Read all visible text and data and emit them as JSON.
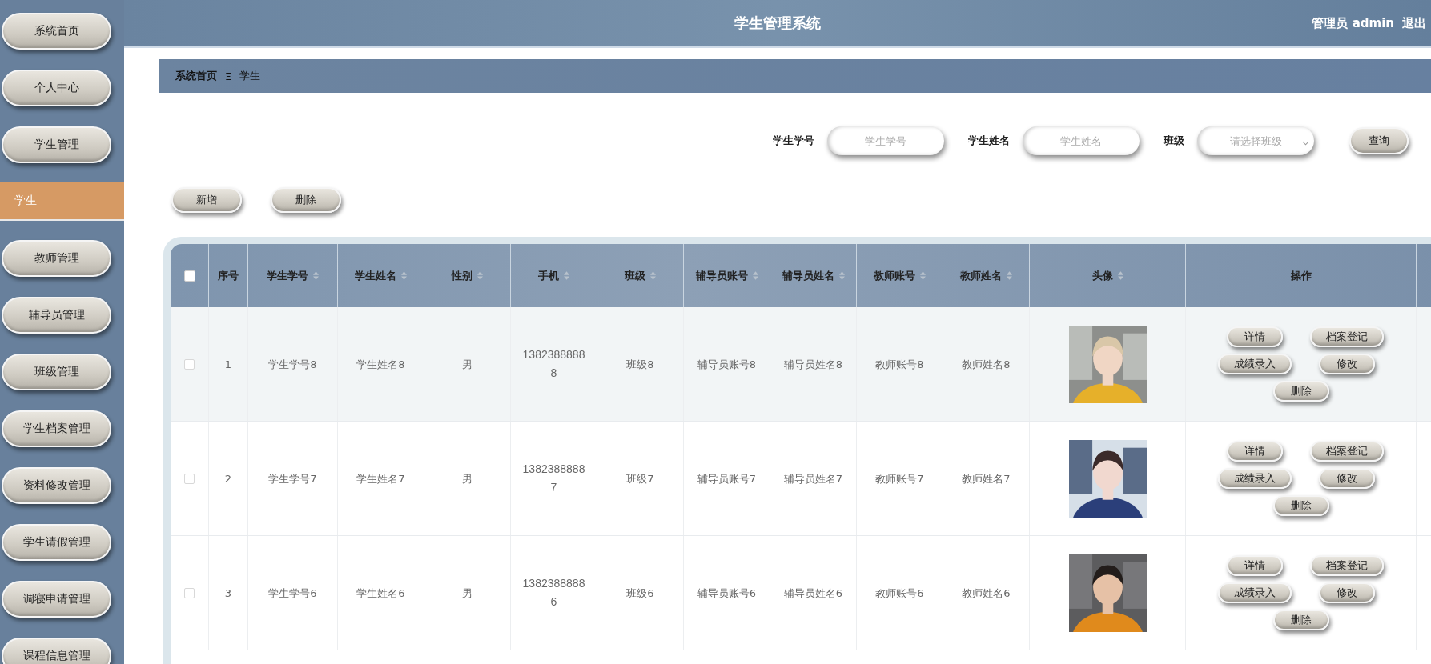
{
  "sidebar": {
    "items": [
      {
        "label": "系统首页",
        "selected": false
      },
      {
        "label": "个人中心",
        "selected": false
      },
      {
        "label": "学生管理",
        "selected": false
      },
      {
        "label": "学生",
        "selected": true
      },
      {
        "label": "教师管理",
        "selected": false
      },
      {
        "label": "辅导员管理",
        "selected": false
      },
      {
        "label": "班级管理",
        "selected": false
      },
      {
        "label": "学生档案管理",
        "selected": false
      },
      {
        "label": "资料修改管理",
        "selected": false
      },
      {
        "label": "学生请假管理",
        "selected": false
      },
      {
        "label": "调寝申请管理",
        "selected": false
      },
      {
        "label": "课程信息管理",
        "selected": false
      }
    ]
  },
  "header": {
    "title": "学生管理系统",
    "user": "管理员 admin",
    "logout": "退出"
  },
  "breadcrumb": {
    "items": [
      "系统首页",
      "学生"
    ],
    "separator": "Ξ"
  },
  "search": {
    "fields": [
      {
        "label": "学生学号",
        "placeholder": "学生学号",
        "kind": "input"
      },
      {
        "label": "学生姓名",
        "placeholder": "学生姓名",
        "kind": "input"
      },
      {
        "label": "班级",
        "placeholder": "请选择班级",
        "kind": "select"
      }
    ],
    "button": "查询"
  },
  "toolbar": {
    "buttons": [
      "新增",
      "删除"
    ]
  },
  "table": {
    "header_checkbox": {
      "checked": false
    },
    "columns": [
      {
        "label": "序号",
        "sortable": false
      },
      {
        "label": "学生学号",
        "sortable": true
      },
      {
        "label": "学生姓名",
        "sortable": true
      },
      {
        "label": "性别",
        "sortable": true
      },
      {
        "label": "手机",
        "sortable": true
      },
      {
        "label": "班级",
        "sortable": true
      },
      {
        "label": "辅导员账号",
        "sortable": true
      },
      {
        "label": "辅导员姓名",
        "sortable": true
      },
      {
        "label": "教师账号",
        "sortable": true
      },
      {
        "label": "教师姓名",
        "sortable": true
      },
      {
        "label": "头像",
        "sortable": true
      },
      {
        "label": "操作",
        "sortable": false
      }
    ],
    "rows": [
      {
        "checked": false,
        "highlighted": true,
        "cells": [
          "1",
          "学生学号8",
          "学生姓名8",
          "男",
          "13823888888",
          "班级8",
          "辅导员账号8",
          "辅导员姓名8",
          "教师账号8",
          "教师姓名8"
        ],
        "actions": [
          "详情",
          "档案登记",
          "成绩录入",
          "修改",
          "删除"
        ]
      },
      {
        "checked": false,
        "highlighted": false,
        "cells": [
          "2",
          "学生学号7",
          "学生姓名7",
          "男",
          "13823888887",
          "班级7",
          "辅导员账号7",
          "辅导员姓名7",
          "教师账号7",
          "教师姓名7"
        ],
        "actions": [
          "详情",
          "档案登记",
          "成绩录入",
          "修改",
          "删除"
        ]
      },
      {
        "checked": false,
        "highlighted": false,
        "cells": [
          "3",
          "学生学号6",
          "学生姓名6",
          "男",
          "13823888886",
          "班级6",
          "辅导员账号6",
          "辅导员姓名6",
          "教师账号6",
          "教师姓名6"
        ],
        "actions": [
          "详情",
          "档案登记",
          "成绩录入",
          "修改",
          "删除"
        ]
      }
    ]
  }
}
